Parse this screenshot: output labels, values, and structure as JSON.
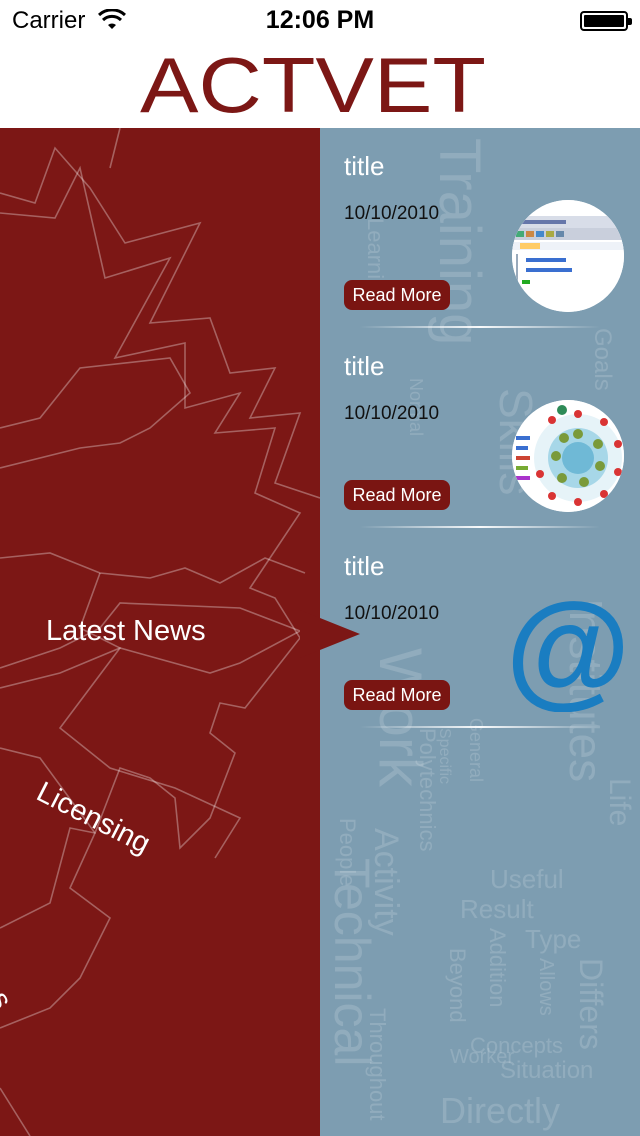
{
  "status_bar": {
    "carrier": "Carrier",
    "time": "12:06 PM"
  },
  "header": {
    "logo_text": "ACTVET"
  },
  "menu": {
    "items": [
      {
        "label": "Latest News"
      },
      {
        "label": "Licensing"
      },
      {
        "label": "Institutes"
      }
    ]
  },
  "news": {
    "items": [
      {
        "title": "title",
        "date": "10/10/2010",
        "read_more_label": "Read More",
        "thumbnail_icon": "screenshot-thumbnail"
      },
      {
        "title": "title",
        "date": "10/10/2010",
        "read_more_label": "Read More",
        "thumbnail_icon": "circle-diagram-thumbnail"
      },
      {
        "title": "title",
        "date": "10/10/2010",
        "read_more_label": "Read More",
        "thumbnail_icon": "at-sign-icon"
      }
    ]
  },
  "background_words": [
    "Training",
    "Institutes",
    "Work",
    "Skills",
    "Activity",
    "Technical",
    "Result",
    "Useful",
    "Directly",
    "Situation",
    "Concepts",
    "Beyond",
    "Addition",
    "Type",
    "Allows",
    "Differs",
    "Worker",
    "Throughout",
    "People",
    "Goals",
    "Normal",
    "Learning",
    "Polytechnics",
    "General",
    "Specific",
    "Life"
  ],
  "colors": {
    "brand": "#7c1715",
    "panel_blue": "#7d9db1",
    "button": "#7a1512",
    "at_sign": "#1a7dc1"
  }
}
